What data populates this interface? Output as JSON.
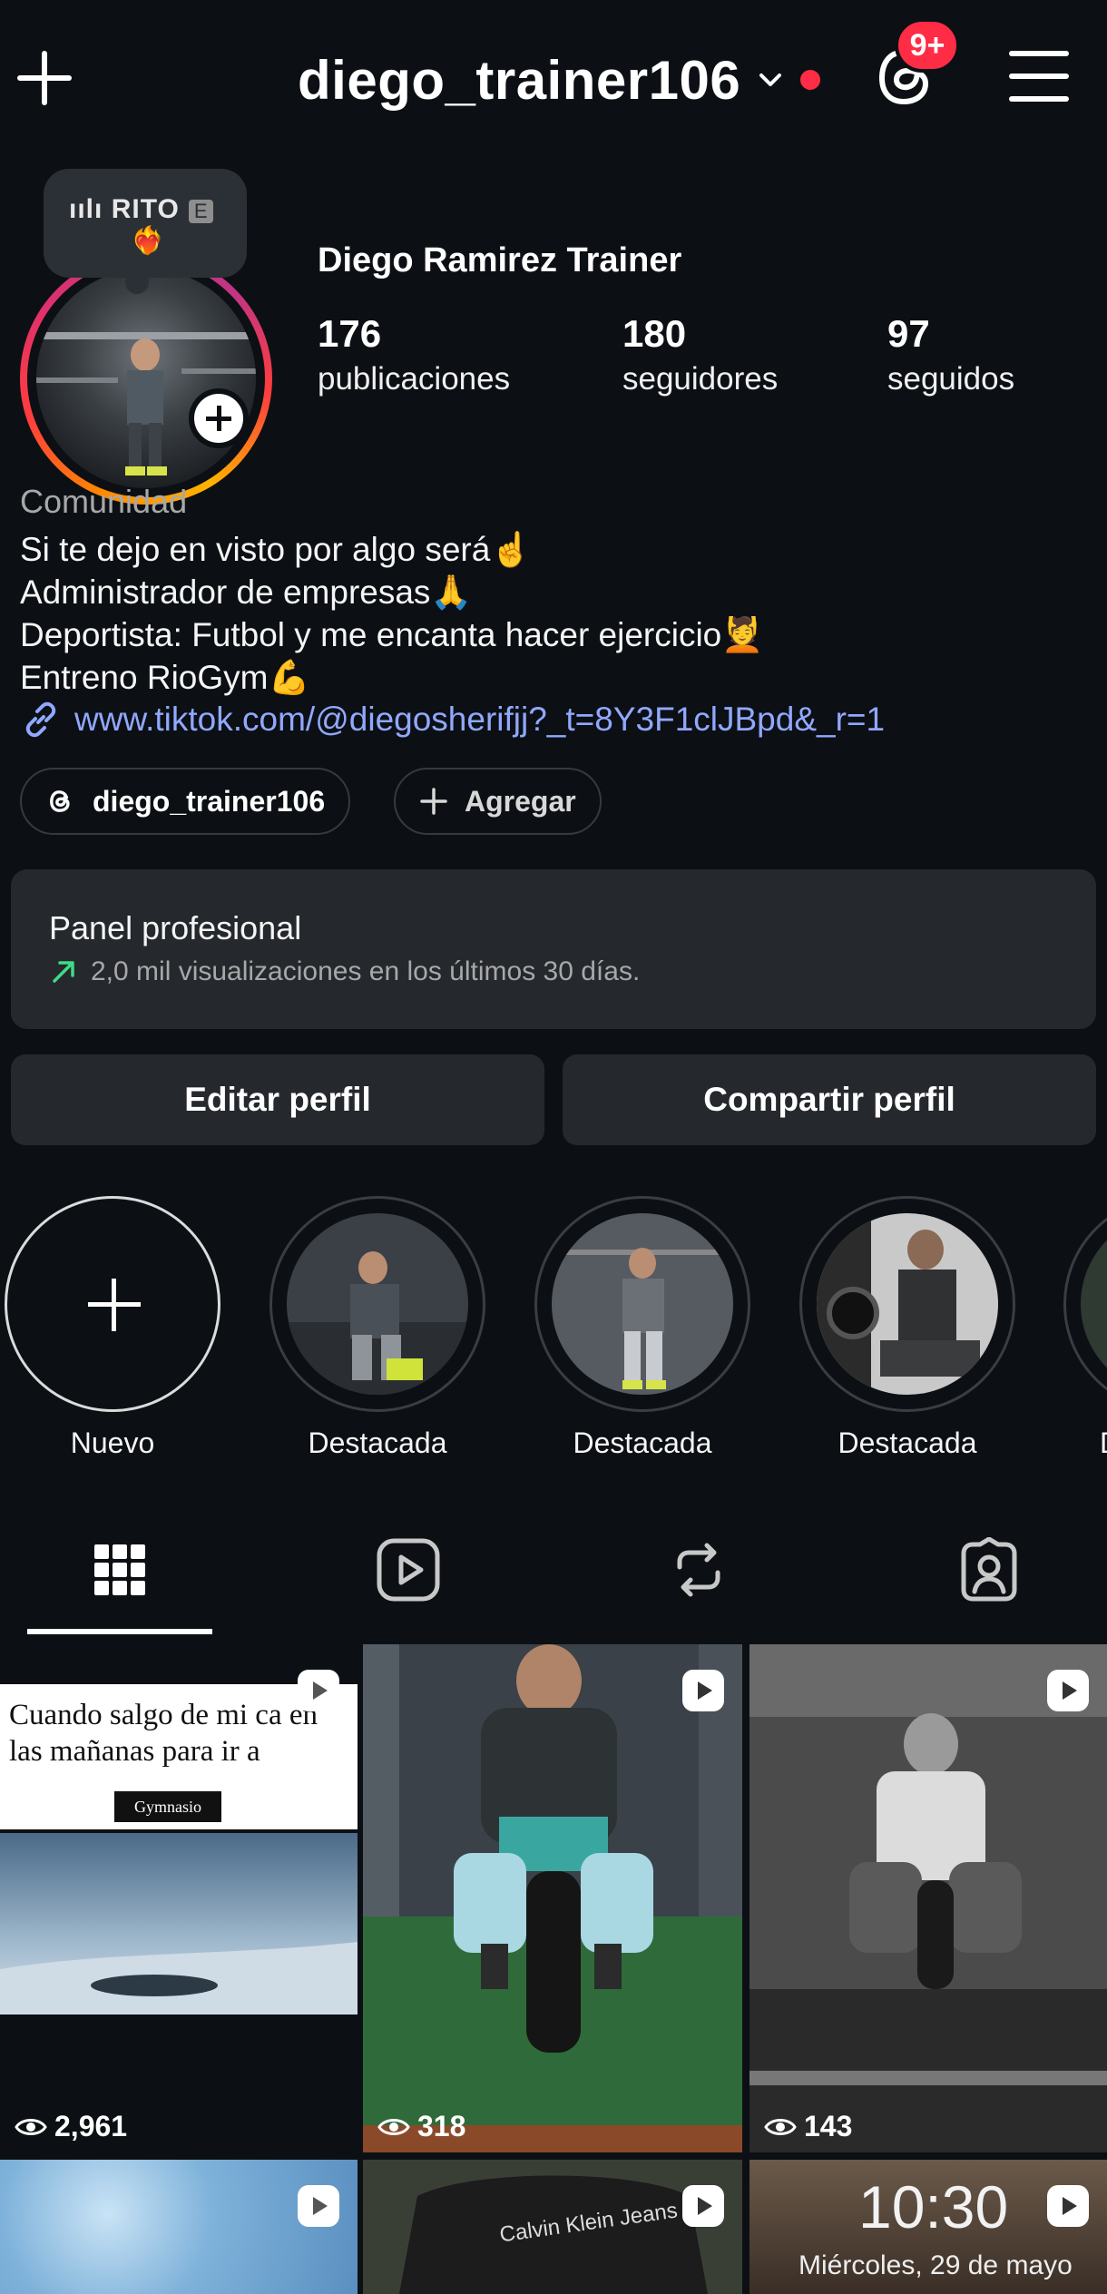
{
  "header": {
    "username": "diego_trainer106",
    "notification_badge": "9+",
    "accent_red": "#ff2c45"
  },
  "note": {
    "text": "RITO",
    "tag": "E",
    "emoji": "❤️‍🔥"
  },
  "profile": {
    "display_name": "Diego Ramirez Trainer",
    "stats": [
      {
        "value": "176",
        "label": "publicaciones"
      },
      {
        "value": "180",
        "label": "seguidores"
      },
      {
        "value": "97",
        "label": "seguidos"
      }
    ],
    "category": "Comunidad",
    "bio_lines": [
      "Si te dejo en visto por algo será☝️",
      "Administrador de empresas🙏",
      "Deportista: Futbol y me encanta hacer ejercicio💆",
      "Entreno RioGym💪"
    ],
    "link": "www.tiktok.com/@diegosherifjj?_t=8Y3F1clJBpd&_r=1",
    "link_color": "#91a8ff"
  },
  "pills": {
    "threads": "diego_trainer106",
    "add": "Agregar"
  },
  "pro_panel": {
    "title": "Panel profesional",
    "subtitle": "2,0 mil visualizaciones en los últimos 30 días."
  },
  "buttons": {
    "edit": "Editar perfil",
    "share": "Compartir perfil"
  },
  "highlights": [
    {
      "label": "Nuevo"
    },
    {
      "label": "Destacada"
    },
    {
      "label": "Destacada"
    },
    {
      "label": "Destacada"
    },
    {
      "label": "D"
    }
  ],
  "posts": [
    {
      "views": "2,961",
      "caption": "Cuando salgo de mi ca en las mañanas para ir a",
      "tag": "Gymnasio"
    },
    {
      "views": "318"
    },
    {
      "views": "143"
    },
    {
      "views": ""
    },
    {
      "views": "",
      "overlay": "Calvin Klein Jeans"
    },
    {
      "views": "",
      "clock": "10:30",
      "date": "Miércoles, 29 de mayo"
    }
  ]
}
